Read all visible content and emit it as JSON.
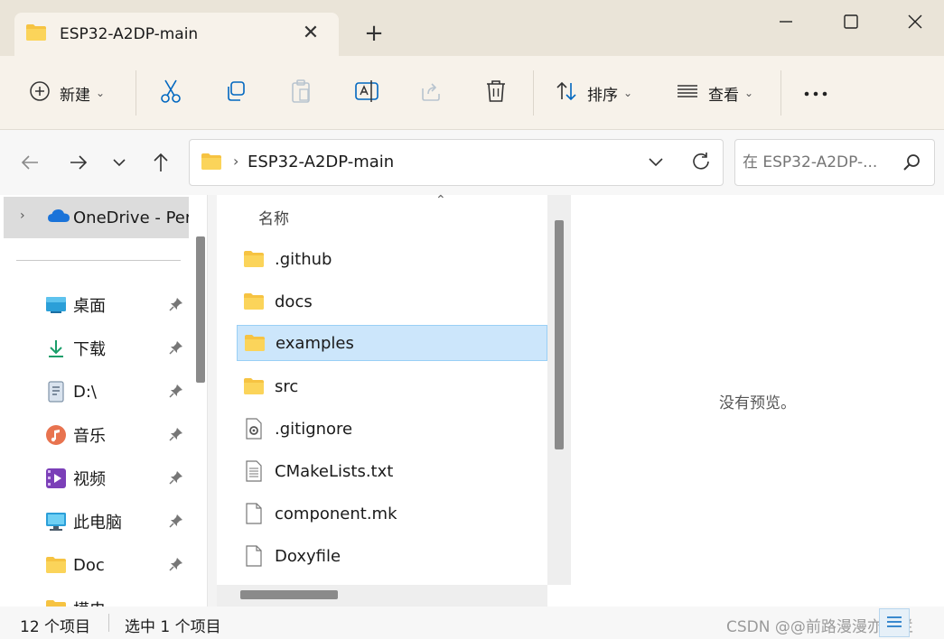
{
  "window": {
    "tab_title": "ESP32-A2DP-main",
    "colors": {
      "folder": "#f6c342",
      "selection": "#cce6fb",
      "accent": "#0067c0"
    }
  },
  "toolbar": {
    "new_label": "新建",
    "sort_label": "排序",
    "view_label": "查看"
  },
  "address": {
    "crumb": "ESP32-A2DP-main",
    "search_placeholder": "在 ESP32-A2DP-..."
  },
  "sidebar": {
    "onedrive_label": "OneDrive - Per",
    "items": [
      {
        "label": "桌面",
        "icon": "desktop-icon"
      },
      {
        "label": "下载",
        "icon": "download-icon"
      },
      {
        "label": "D:\\",
        "icon": "drive-icon"
      },
      {
        "label": "音乐",
        "icon": "music-icon"
      },
      {
        "label": "视频",
        "icon": "video-icon"
      },
      {
        "label": "此电脑",
        "icon": "computer-icon"
      },
      {
        "label": "Doc",
        "icon": "folder-icon"
      },
      {
        "label": "模电",
        "icon": "folder-icon"
      }
    ]
  },
  "filelist": {
    "column_name": "名称",
    "rows": [
      {
        "name": ".github",
        "type": "folder"
      },
      {
        "name": "docs",
        "type": "folder"
      },
      {
        "name": "examples",
        "type": "folder",
        "selected": true
      },
      {
        "name": "src",
        "type": "folder"
      },
      {
        "name": ".gitignore",
        "type": "config-file"
      },
      {
        "name": "CMakeLists.txt",
        "type": "text-file"
      },
      {
        "name": "component.mk",
        "type": "file"
      },
      {
        "name": "Doxyfile",
        "type": "file"
      }
    ]
  },
  "preview": {
    "text": "没有预览。"
  },
  "status": {
    "count": "12 个项目",
    "selected": "选中 1 个项目",
    "watermark": "CSDN @@前路漫漫亦灿烂"
  }
}
